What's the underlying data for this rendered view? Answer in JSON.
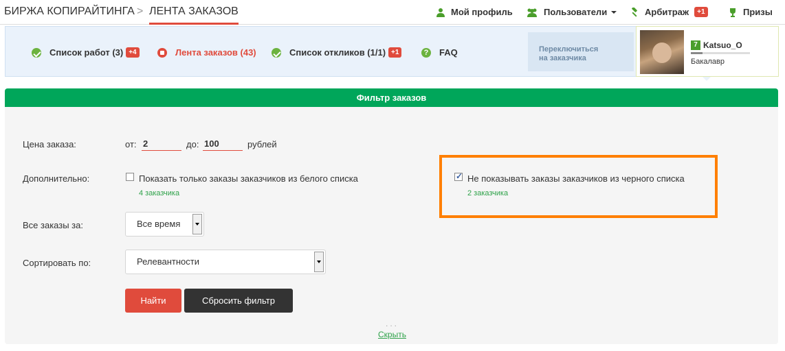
{
  "topbar": {
    "site_name": "БИРЖА КОПИРАЙТИНГА",
    "separator": ">",
    "current_page": "ЛЕНТА ЗАКАЗОВ",
    "nav": {
      "profile": "Мой профиль",
      "users": "Пользователи",
      "arbitrage": "Арбитраж",
      "arbitrage_badge": "+1",
      "prizes": "Призы"
    }
  },
  "subnav": {
    "items": [
      {
        "label": "Список работ (3)",
        "badge": "+4"
      },
      {
        "label": "Лента заказов (43)",
        "badge": ""
      },
      {
        "label": "Список откликов (1/1)",
        "badge": "+1"
      },
      {
        "label": "FAQ",
        "badge": ""
      }
    ],
    "switch_label_line1": "Переключиться",
    "switch_label_line2": "на заказчика",
    "user": {
      "level": "7",
      "name": "Katsuo_O",
      "rank": "Бакалавр"
    }
  },
  "filter": {
    "title": "Фильтр заказов",
    "price_label": "Цена заказа:",
    "from_label": "от:",
    "from_value": "2",
    "to_label": "до:",
    "to_value": "100",
    "currency": "рублей",
    "extra_label": "Дополнительно:",
    "whitelist_label": "Показать только заказы заказчиков из белого списка",
    "whitelist_count": "4 заказчика",
    "whitelist_checked": false,
    "blacklist_label": "Не показывать заказы заказчиков из черного списка",
    "blacklist_count": "2 заказчика",
    "blacklist_checked": true,
    "period_label": "Все заказы за:",
    "period_value": "Все время",
    "sort_label": "Сортировать по:",
    "sort_value": "Релевантности",
    "find_button": "Найти",
    "reset_button": "Сбросить фильтр",
    "dots": "...",
    "hide_link": "Скрыть"
  },
  "colors": {
    "accent_green": "#00a65a",
    "accent_red": "#e04b3c",
    "highlight_orange": "#ff7f00"
  }
}
